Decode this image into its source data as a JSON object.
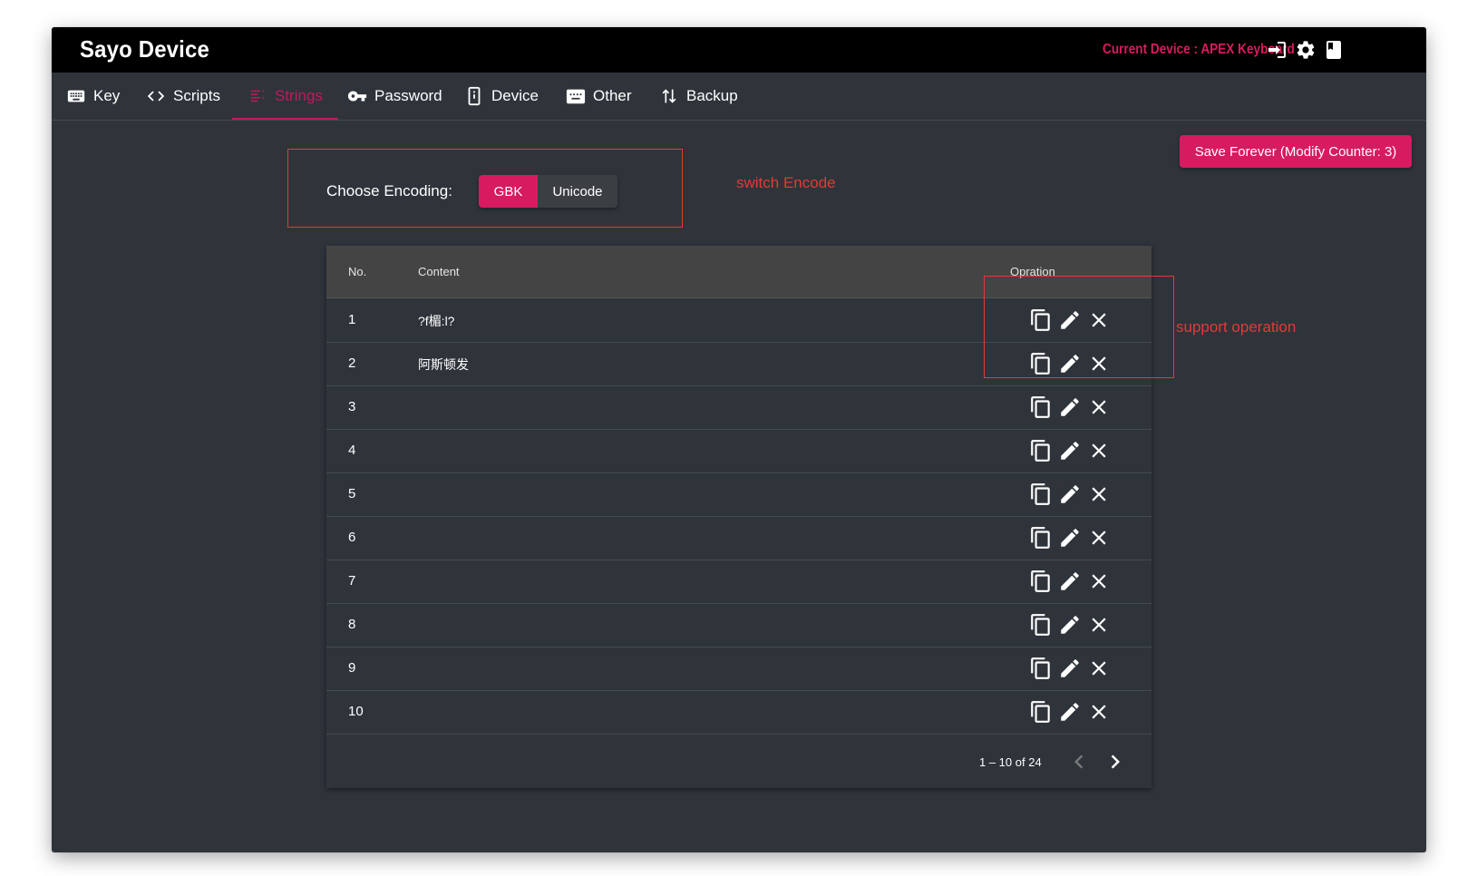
{
  "app": {
    "title": "Sayo Device",
    "current_device": "Current Device :  APEX Keyboard",
    "icons": [
      "login-icon",
      "gear-icon",
      "book-icon"
    ]
  },
  "tabs": [
    {
      "label": "Key",
      "icon": "keyboard-icon"
    },
    {
      "label": "Scripts",
      "icon": "code-icon"
    },
    {
      "label": "Strings",
      "icon": "list-icon",
      "active": true
    },
    {
      "label": "Password",
      "icon": "key-icon"
    },
    {
      "label": "Device",
      "icon": "device-icon"
    },
    {
      "label": "Other",
      "icon": "keyboard-alt-icon"
    },
    {
      "label": "Backup",
      "icon": "swap-vertical-icon"
    }
  ],
  "save_button": "Save Forever (Modify Counter: 3)",
  "encoding": {
    "label": "Choose Encoding:",
    "options": [
      "GBK",
      "Unicode"
    ],
    "selected": "GBK"
  },
  "annotations": {
    "switch_encode": "switch Encode",
    "support_operation": "support operation"
  },
  "table": {
    "headers": [
      "No.",
      "Content",
      "Opration"
    ],
    "rows": [
      {
        "no": "1",
        "content": "?f楣:l?"
      },
      {
        "no": "2",
        "content": "阿斯顿发"
      },
      {
        "no": "3",
        "content": ""
      },
      {
        "no": "4",
        "content": ""
      },
      {
        "no": "5",
        "content": ""
      },
      {
        "no": "6",
        "content": ""
      },
      {
        "no": "7",
        "content": ""
      },
      {
        "no": "8",
        "content": ""
      },
      {
        "no": "9",
        "content": ""
      },
      {
        "no": "10",
        "content": ""
      }
    ],
    "row_operations": [
      "copy-icon",
      "edit-icon",
      "close-icon"
    ],
    "pagination": "1 – 10 of 24"
  },
  "colors": {
    "accent": "#d81b60",
    "background": "#2f343b",
    "titlebar": "#000000",
    "header_row": "#444444",
    "annotation": "#e53935"
  }
}
